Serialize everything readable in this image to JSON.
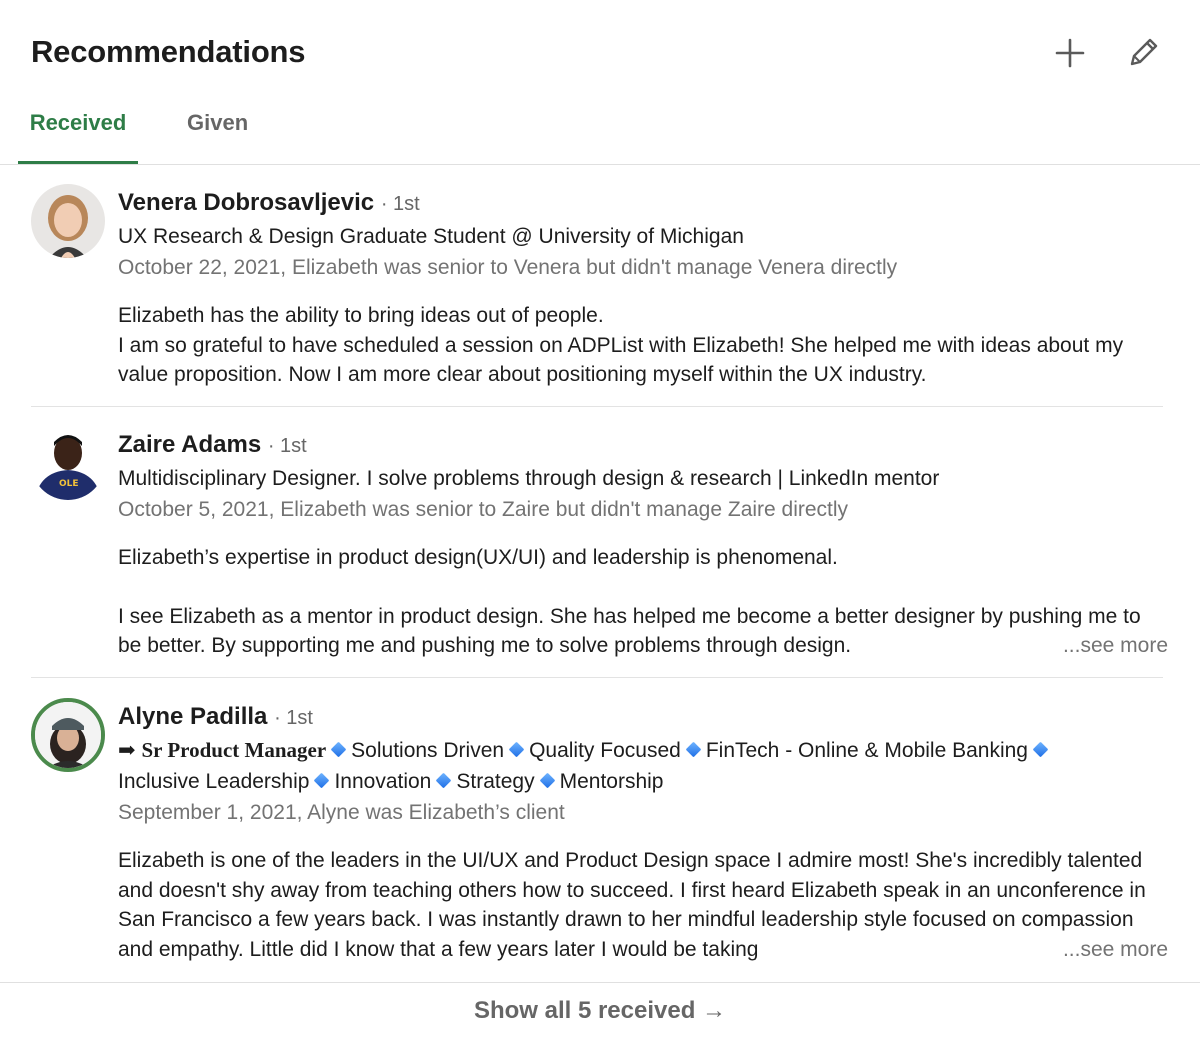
{
  "section": {
    "title": "Recommendations",
    "actions": {
      "add_icon": "plus-icon",
      "edit_icon": "pencil-icon"
    }
  },
  "tabs": [
    {
      "label": "Received",
      "active": true
    },
    {
      "label": "Given",
      "active": false
    }
  ],
  "accent_color": "#2e7d47",
  "recommendations": [
    {
      "name": "Venera Dobrosavljevic",
      "degree": "· 1st",
      "headline": "UX Research & Design Graduate Student @ University of Michigan",
      "meta": "October 22, 2021, Elizabeth was senior to Venera but didn't manage Venera directly",
      "text_line1": "Elizabeth has the ability to bring ideas out of people.",
      "text_line2": "I am so grateful to have scheduled a session on ADPList with Elizabeth! She helped me with ideas about my value proposition. Now I am more clear about positioning myself within the UX industry."
    },
    {
      "name": "Zaire Adams",
      "degree": "· 1st",
      "headline": "Multidisciplinary Designer. I solve problems through design & research | LinkedIn mentor",
      "meta": "October 5, 2021, Elizabeth was senior to Zaire but didn't manage Zaire directly",
      "text_line1": "Elizabeth’s expertise in product design(UX/UI) and leadership is phenomenal.",
      "text_line2": "I see Elizabeth as a mentor in product design. She has helped me become a better designer by pushing me to be better. By supporting me and pushing me to solve problems through design.",
      "see_more": "...see more"
    },
    {
      "name": "Alyne Padilla",
      "degree": "· 1st",
      "headline_arrow": "➡",
      "headline_title": "Sr Product Manager",
      "headline_items": [
        "Solutions Driven",
        "Quality Focused",
        "FinTech - Online & Mobile Banking",
        "Inclusive Leadership",
        "Innovation",
        "Strategy",
        "Mentorship"
      ],
      "meta": "September 1, 2021, Alyne was Elizabeth’s client",
      "text": "Elizabeth is one of the leaders in the UI/UX and Product Design space I admire most! She's incredibly talented and doesn't shy away from teaching others how to succeed. I first heard Elizabeth speak in an unconference in San Francisco a few years back. I was instantly drawn to her mindful leadership style focused on compassion and empathy. Little did I know that a few years later I would be taking",
      "see_more": "...see more"
    }
  ],
  "footer": {
    "show_all_label": "Show all 5 received →"
  }
}
